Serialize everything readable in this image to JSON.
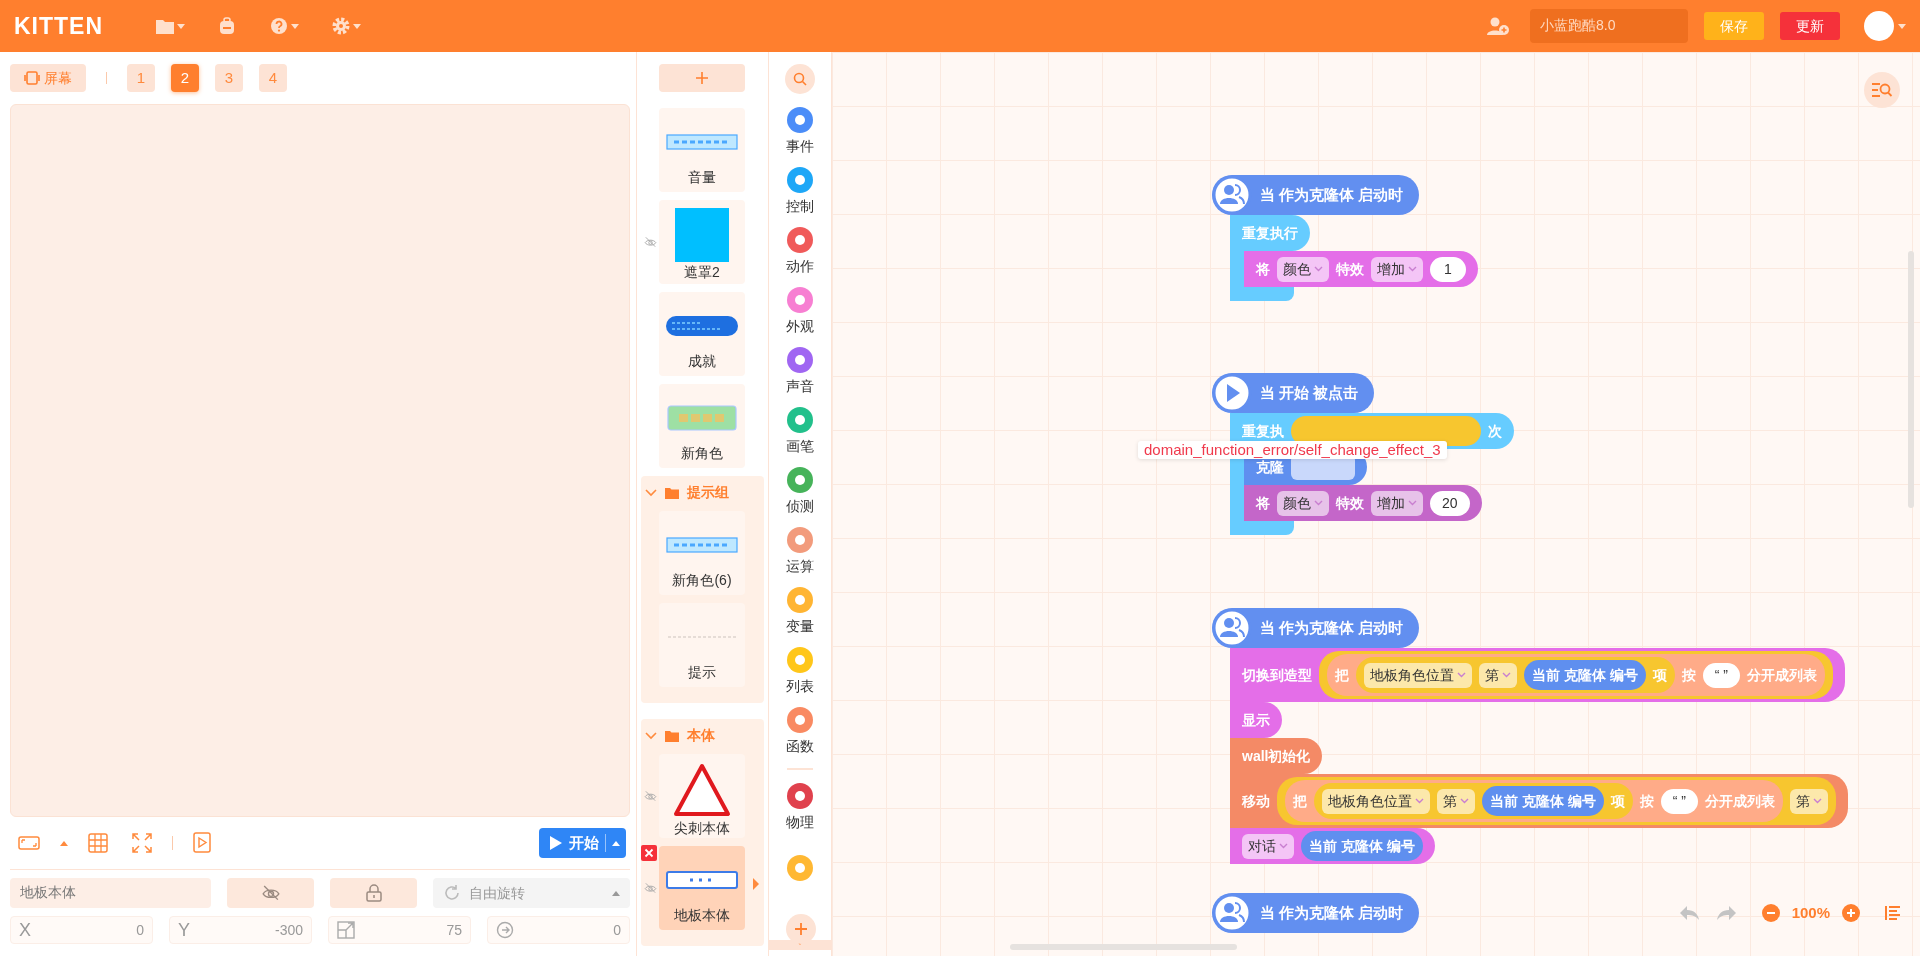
{
  "topbar": {
    "logo": "KITTEN",
    "project_name": "小蓝跑酷8.0",
    "save_label": "保存",
    "update_label": "更新"
  },
  "stage": {
    "screen_label": "屏幕",
    "scenes": [
      {
        "label": "1",
        "selected": false
      },
      {
        "label": "2",
        "selected": true
      },
      {
        "label": "3",
        "selected": false
      },
      {
        "label": "4",
        "selected": false
      }
    ],
    "start_label": "开始"
  },
  "properties": {
    "name": "地板本体",
    "visible": false,
    "rotation_mode": "自由旋转",
    "fields": [
      {
        "kind": "x",
        "label": "X",
        "value": "0"
      },
      {
        "kind": "y",
        "label": "Y",
        "value": "-300"
      },
      {
        "kind": "size",
        "value": "75"
      },
      {
        "kind": "rotation",
        "value": "0"
      }
    ]
  },
  "sprites": [
    {
      "kind": "banner",
      "name": "音量",
      "hidden": false,
      "selected": false
    },
    {
      "kind": "square",
      "name": "遮罩2",
      "hidden": true,
      "selected": false
    },
    {
      "kind": "pill",
      "name": "成就",
      "hidden": false,
      "selected": false
    },
    {
      "kind": "badge",
      "name": "新角色",
      "hidden": false,
      "selected": false
    },
    {
      "kind": "group",
      "name": "提示组",
      "expanded": true,
      "children": [
        {
          "kind": "banner",
          "name": "新角色(6)",
          "hidden": false,
          "selected": false
        },
        {
          "kind": "blank",
          "name": "提示",
          "hidden": false,
          "selected": false
        }
      ]
    },
    {
      "kind": "group",
      "name": "本体",
      "expanded": true,
      "children": [
        {
          "kind": "triangle",
          "name": "尖刺本体",
          "hidden": true,
          "selected": false
        },
        {
          "kind": "frame",
          "name": "地板本体",
          "hidden": true,
          "selected": true
        }
      ]
    }
  ],
  "categories": [
    {
      "kind": "category",
      "label": "事件",
      "color": "#4b8df8"
    },
    {
      "kind": "category",
      "label": "控制",
      "color": "#1ea7f7"
    },
    {
      "kind": "category",
      "label": "动作",
      "color": "#f05a5a"
    },
    {
      "kind": "category",
      "label": "外观",
      "color": "#f77fd2"
    },
    {
      "kind": "category",
      "label": "声音",
      "color": "#a066f2"
    },
    {
      "kind": "category",
      "label": "画笔",
      "color": "#22c08b"
    },
    {
      "kind": "category",
      "label": "侦测",
      "color": "#46b35a"
    },
    {
      "kind": "category",
      "label": "运算",
      "color": "#f29b7c"
    },
    {
      "kind": "category",
      "label": "变量",
      "color": "#ffb533"
    },
    {
      "kind": "category",
      "label": "列表",
      "color": "#ffc61a"
    },
    {
      "kind": "category",
      "label": "函数",
      "color": "#f98a62"
    },
    {
      "kind": "divider"
    },
    {
      "kind": "category",
      "label": "物理",
      "color": "#e0414d"
    },
    {
      "kind": "category",
      "color": "#ffb833"
    }
  ],
  "scripts": [
    {
      "hat": {
        "kind": "clone",
        "text": "当 作为克隆体 启动时"
      },
      "blocks": [
        {
          "kind": "repeat",
          "color": "#66ccff",
          "parts": [
            {
              "kind": "text",
              "text": "重复执行"
            }
          ],
          "children": [
            {
              "kind": "stack",
              "color": "#e46ee8",
              "parts": [
                {
                  "kind": "text",
                  "text": "将"
                },
                {
                  "kind": "dropdown",
                  "text": "颜色"
                },
                {
                  "kind": "text",
                  "text": "特效"
                },
                {
                  "kind": "dropdown",
                  "text": "增加"
                },
                {
                  "kind": "number",
                  "text": "1"
                }
              ]
            }
          ]
        }
      ]
    },
    {
      "hat": {
        "kind": "start",
        "text": "当 开始 被点击"
      },
      "blocks": [
        {
          "kind": "repeat",
          "color": "#66ccff",
          "parts": [
            {
              "kind": "text",
              "text": "重复执"
            },
            {
              "kind": "slot",
              "color": "#f7c62f"
            },
            {
              "kind": "text",
              "text": "次"
            }
          ],
          "children": [
            {
              "kind": "stack",
              "color": "#5f8fef",
              "parts": [
                {
                  "kind": "text",
                  "text": "克隆"
                },
                {
                  "kind": "slot"
                }
              ]
            },
            {
              "kind": "stack",
              "color": "#c466c9",
              "parts": [
                {
                  "kind": "text",
                  "text": "将"
                },
                {
                  "kind": "dropdown",
                  "text": "颜色"
                },
                {
                  "kind": "text",
                  "text": "特效"
                },
                {
                  "kind": "dropdown",
                  "text": "增加"
                },
                {
                  "kind": "number",
                  "text": "20"
                }
              ]
            }
          ]
        }
      ]
    },
    {
      "hat": {
        "kind": "clone",
        "text": "当 作为克隆体 启动时"
      },
      "blocks": [
        {
          "kind": "stack",
          "color": "#e46ee8",
          "parts": [
            {
              "kind": "text",
              "text": "切换到造型"
            },
            {
              "kind": "reporter",
              "color": "#f7c62f",
              "parts": [
                {
                  "kind": "reporter",
                  "color": "#ffab88",
                  "parts": [
                    {
                      "kind": "text",
                      "text": "把"
                    },
                    {
                      "kind": "reporter",
                      "color": "#f7c62f",
                      "parts": [
                        {
                          "kind": "dropdown",
                          "text": "地板角色位置"
                        },
                        {
                          "kind": "dropdown",
                          "text": "第"
                        },
                        {
                          "kind": "reporter",
                          "color": "#5f8fef",
                          "parts": [
                            {
                              "kind": "text",
                              "text": "当前 克隆体 编号"
                            }
                          ]
                        },
                        {
                          "kind": "text",
                          "text": "项"
                        }
                      ]
                    },
                    {
                      "kind": "text",
                      "text": "按"
                    },
                    {
                      "kind": "string",
                      "text": "“ ”"
                    },
                    {
                      "kind": "text",
                      "text": "分开成列表"
                    }
                  ]
                }
              ]
            }
          ]
        },
        {
          "kind": "stack",
          "color": "#e46ee8",
          "parts": [
            {
              "kind": "text",
              "text": "显示"
            }
          ]
        },
        {
          "kind": "stack",
          "color": "#f48a66",
          "parts": [
            {
              "kind": "text",
              "text": "wall初始化"
            }
          ]
        },
        {
          "kind": "stack",
          "color": "#f48a66",
          "parts": [
            {
              "kind": "text",
              "text": "移动"
            },
            {
              "kind": "reporter",
              "color": "#f7c62f",
              "parts": [
                {
                  "kind": "reporter",
                  "color": "#ffab88",
                  "parts": [
                    {
                      "kind": "text",
                      "text": "把"
                    },
                    {
                      "kind": "reporter",
                      "color": "#f7c62f",
                      "parts": [
                        {
                          "kind": "dropdown",
                          "text": "地板角色位置"
                        },
                        {
                          "kind": "dropdown",
                          "text": "第"
                        },
                        {
                          "kind": "reporter",
                          "color": "#5f8fef",
                          "parts": [
                            {
                              "kind": "text",
                              "text": "当前 克隆体 编号"
                            }
                          ]
                        },
                        {
                          "kind": "text",
                          "text": "项"
                        }
                      ]
                    },
                    {
                      "kind": "text",
                      "text": "按"
                    },
                    {
                      "kind": "string",
                      "text": "“ ”"
                    },
                    {
                      "kind": "text",
                      "text": "分开成列表"
                    }
                  ]
                },
                {
                  "kind": "dropdown",
                  "text": "第"
                }
              ]
            }
          ]
        },
        {
          "kind": "stack",
          "color": "#e46ee8",
          "parts": [
            {
              "kind": "dropdown",
              "text": "对话"
            },
            {
              "kind": "reporter",
              "color": "#5f8fef",
              "parts": [
                {
                  "kind": "text",
                  "text": "当前 克隆体 编号"
                }
              ]
            }
          ]
        }
      ]
    },
    {
      "hat": {
        "kind": "clone",
        "text": "当 作为克隆体 启动时"
      }
    }
  ],
  "tooltip": {
    "text": "domain_function_error/self_change_effect_3"
  },
  "zoom": {
    "label": "100%"
  }
}
